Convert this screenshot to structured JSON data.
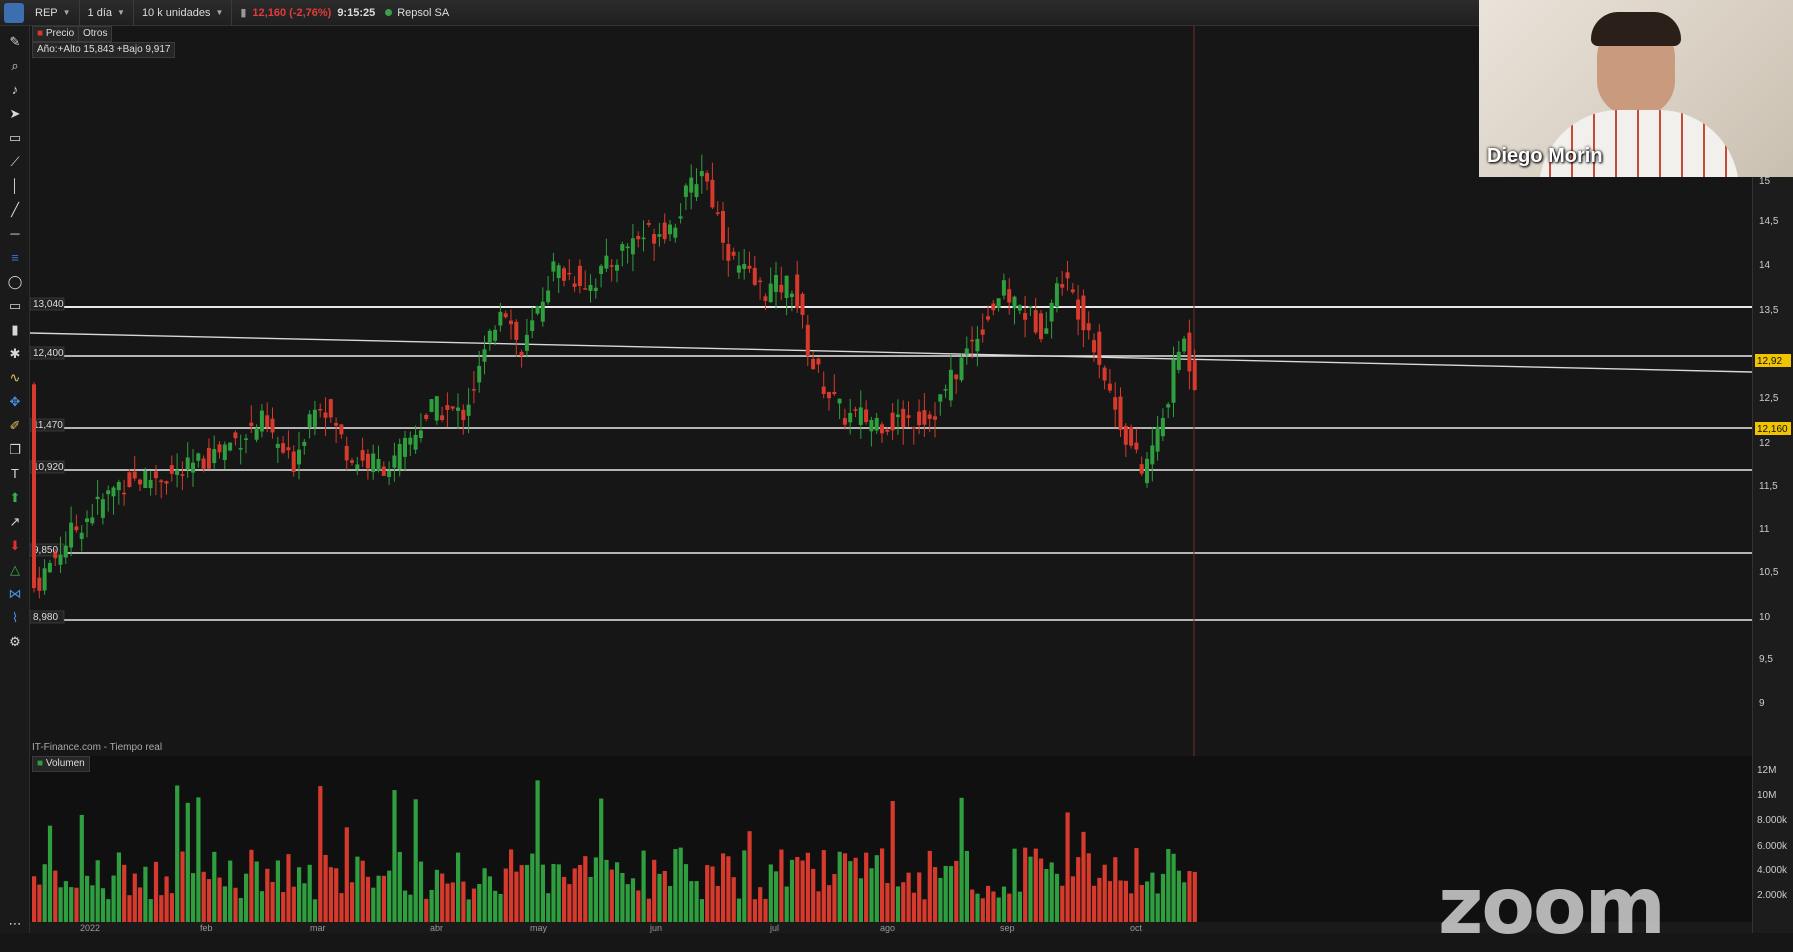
{
  "toolbar": {
    "ticker": "REP",
    "interval": "1 día",
    "units": "10 k unidades",
    "price_change": "12,160 (-2,76%)",
    "time": "9:15:25",
    "company": "Repsol SA"
  },
  "chart_legend": {
    "tab_price": "Precio",
    "tab_other": "Otros",
    "year_range": "Año:+Alto 15,843 +Bajo 9,917",
    "source": "IT-Finance.com - Tiempo real",
    "volume_label": "Volumen"
  },
  "price_levels": [
    "13,040",
    "12,400",
    "11,470",
    "10,920",
    "9,850",
    "8,980"
  ],
  "right_axis": {
    "price_ticks": [
      "15",
      "14,5",
      "14",
      "13,5",
      "12,92",
      "12,5",
      "12,160",
      "12",
      "11,5",
      "11",
      "10,5",
      "10",
      "9,5",
      "9"
    ],
    "volume_ticks": [
      "12M",
      "10M",
      "8.000k",
      "6.000k",
      "4.000k",
      "2.000k"
    ],
    "current_price": "12,160",
    "marker_price": "12,92"
  },
  "x_axis": {
    "labels": [
      "2022",
      "feb",
      "mar",
      "abr",
      "may",
      "jun",
      "jul",
      "ago",
      "sep",
      "oct"
    ]
  },
  "webcam": {
    "participant_name": "Diego Morin"
  },
  "watermark": "zoom",
  "colors": {
    "up": "#2f9e3f",
    "down": "#d63a2c",
    "level_line": "#e8e8e8",
    "background": "#161616"
  }
}
